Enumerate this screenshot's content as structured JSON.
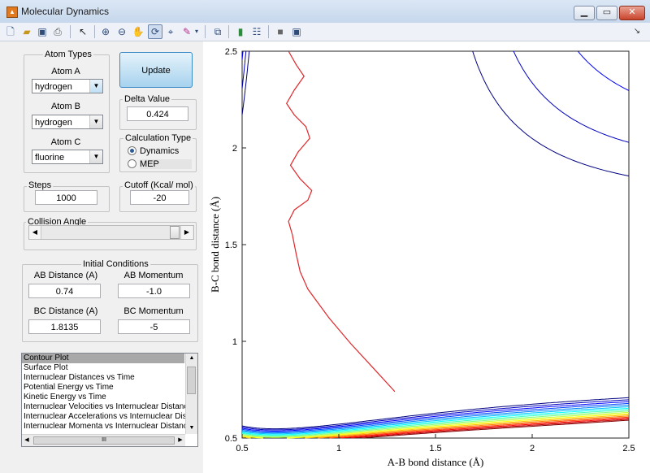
{
  "window": {
    "title": "Molecular Dynamics",
    "controls": [
      "minimize-icon",
      "restore-icon",
      "close-icon"
    ]
  },
  "toolbar": {
    "icons": [
      "new-file-icon",
      "open-folder-icon",
      "save-icon",
      "print-icon",
      "pointer-icon",
      "zoom-in-icon",
      "zoom-out-icon",
      "pan-hand-icon",
      "rotate-3d-icon",
      "data-cursor-icon",
      "brush-icon",
      "link-plot-icon",
      "colorbar-icon",
      "legend-icon",
      "hide-plot-tools-icon",
      "show-plot-tools-icon",
      "dock-arrow-icon"
    ]
  },
  "atom_types": {
    "title": "Atom Types",
    "atom_a": {
      "label": "Atom A",
      "value": "hydrogen"
    },
    "atom_b": {
      "label": "Atom B",
      "value": "hydrogen"
    },
    "atom_c": {
      "label": "Atom C",
      "value": "fluorine"
    }
  },
  "update_label": "Update",
  "delta": {
    "label": "Delta Value",
    "value": "0.424"
  },
  "calc_type": {
    "label": "Calculation Type",
    "options": [
      "Dynamics",
      "MEP"
    ],
    "selected": "Dynamics"
  },
  "steps": {
    "label": "Steps",
    "value": "1000"
  },
  "cutoff": {
    "label": "Cutoff (Kcal/ mol)",
    "value": "-20"
  },
  "collision": {
    "label": "Collision Angle"
  },
  "initial": {
    "title": "Initial Conditions",
    "ab_distance": {
      "label": "AB Distance (A)",
      "value": "0.74"
    },
    "ab_momentum": {
      "label": "AB Momentum",
      "value": "-1.0"
    },
    "bc_distance": {
      "label": "BC Distance (A)",
      "value": "1.8135"
    },
    "bc_momentum": {
      "label": "BC Momentum",
      "value": "-5"
    }
  },
  "plot_types": {
    "items": [
      "Contour Plot",
      "Surface Plot",
      "Internuclear Distances vs Time",
      "Potential Energy vs Time",
      "Kinetic Energy vs Time",
      "Internuclear Velocities vs Internuclear Distance",
      "Internuclear Accelerations vs Internuclear Dista",
      "Internuclear Momenta vs Internuclear Distance"
    ],
    "selected": "Contour Plot",
    "hscroll_glyph": "III"
  },
  "chart_data": {
    "type": "contour",
    "xlabel": "A-B bond distance (Å)",
    "ylabel": "B-C bond distance (Å)",
    "xlim": [
      0.5,
      2.5
    ],
    "ylim": [
      0.5,
      2.5
    ],
    "xticks": [
      "0.5",
      "1",
      "1.5",
      "2",
      "2.5"
    ],
    "yticks": [
      "0.5",
      "1",
      "1.5",
      "2",
      "2.5"
    ],
    "colormap": "jet",
    "contour_levels": [
      -40,
      -30,
      -20,
      -10,
      0,
      10,
      20,
      30,
      40,
      50,
      60,
      70,
      80,
      90,
      100,
      110,
      120
    ],
    "trajectory_color": "#e0262a",
    "trajectory": [
      [
        1.29,
        0.74
      ],
      [
        1.18,
        0.86
      ],
      [
        1.06,
        0.99
      ],
      [
        0.95,
        1.12
      ],
      [
        0.84,
        1.27
      ],
      [
        0.8,
        1.36
      ],
      [
        0.78,
        1.45
      ],
      [
        0.76,
        1.55
      ],
      [
        0.74,
        1.62
      ],
      [
        0.77,
        1.68
      ],
      [
        0.84,
        1.73
      ],
      [
        0.86,
        1.78
      ],
      [
        0.8,
        1.84
      ],
      [
        0.75,
        1.91
      ],
      [
        0.79,
        1.98
      ],
      [
        0.85,
        2.05
      ],
      [
        0.83,
        2.11
      ],
      [
        0.77,
        2.17
      ],
      [
        0.73,
        2.23
      ],
      [
        0.77,
        2.3
      ],
      [
        0.82,
        2.37
      ],
      [
        0.78,
        2.43
      ],
      [
        0.74,
        2.5
      ]
    ]
  }
}
